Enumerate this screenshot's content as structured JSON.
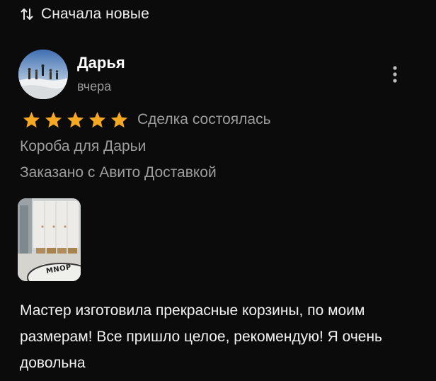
{
  "sort": {
    "label": "Сначала новые",
    "icon": "sort-arrows-icon"
  },
  "review": {
    "author": {
      "name": "Дарья",
      "date": "вчера"
    },
    "rating": 5,
    "rating_max": 5,
    "deal_status": "Сделка состоялась",
    "item_title": "Короба для Дарьи",
    "delivery": "Заказано с Авито Доставкой",
    "photo_caption": "MNOP",
    "text": "Мастер изготовила прекрасные корзины, по моим размерам! Все пришло целое, рекомендую! Я очень довольна"
  },
  "colors": {
    "background": "#0b0b0c",
    "star": "#f7a823",
    "secondary_text": "#9e9e9e"
  }
}
